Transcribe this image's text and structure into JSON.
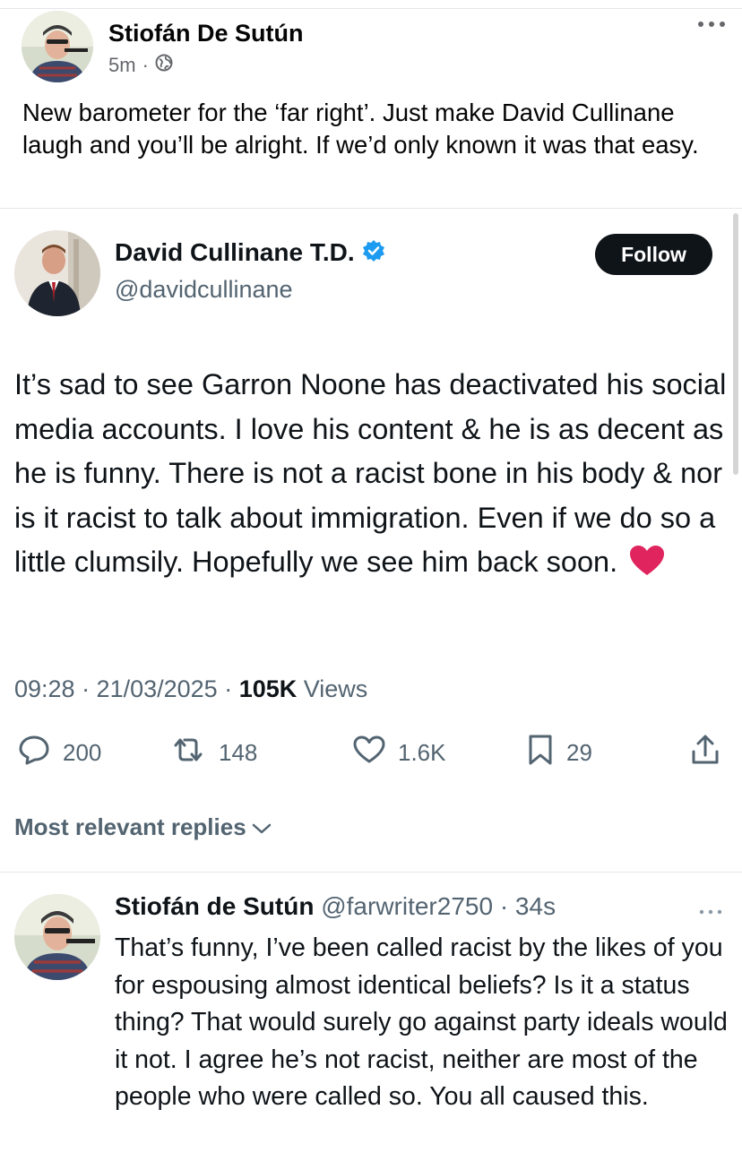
{
  "facebook_post": {
    "author": "Stiofán De Sutún",
    "time": "5m",
    "separator": "·",
    "text": "New barometer for the ‘far right’.  Just make David Cullinane laugh and you’ll be alright.  If we’d only known it was that easy."
  },
  "tweet": {
    "author_name": "David Cullinane T.D.",
    "handle": "@davidcullinane",
    "follow_label": "Follow",
    "text": "It’s sad to see Garron Noone has deactivated his social media accounts. I love his content & he is as decent as he is funny. There is not a racist bone in his body & nor is it racist to talk about immigration. Even if we do so a little clumsily. Hopefully we see him back soon.",
    "emoji": "❤️",
    "time": "09:28 · 21/03/2025 · ",
    "views_count": "105K",
    "views_label": " Views",
    "replies": "200",
    "retweets": "148",
    "likes": "1.6K",
    "bookmarks": "29",
    "sort_label": "Most relevant replies"
  },
  "reply": {
    "author_name": "Stiofán de Sutún",
    "handle_time": " @farwriter2750 · 34s",
    "text": "That’s funny, I’ve been called racist by the likes of you for espousing almost identical beliefs? Is it a status thing? That would surely go against party ideals would it not. I agree he’s not racist, neither are most of the people who were called so. You all caused this."
  },
  "colors": {
    "verified_blue": "#1d9bf0",
    "heart_red": "#e0245e",
    "muted_gray": "#536471",
    "follow_bg": "#0f1419"
  }
}
